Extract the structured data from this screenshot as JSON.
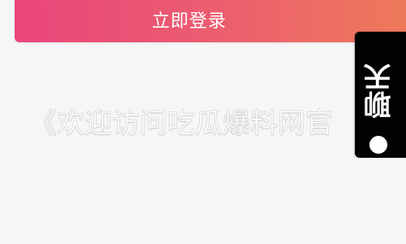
{
  "header": {
    "login_label": "立即登录"
  },
  "banner": {
    "welcome_text": "《欢迎访问吃瓜爆料网官"
  },
  "chat": {
    "label": "聊天",
    "icon": "chat-dot-icon"
  },
  "colors": {
    "login_gradient_start": "#e9467b",
    "login_gradient_end": "#ee7a5a",
    "chat_background": "#020202",
    "page_background": "#f6f6f6"
  }
}
